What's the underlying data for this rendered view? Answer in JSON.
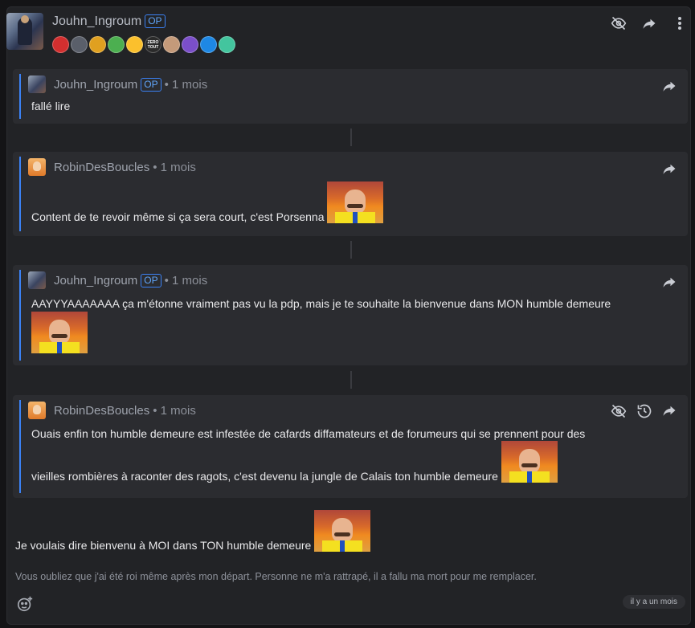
{
  "header": {
    "username": "Jouhn_Ingroum",
    "op": "OP",
    "badges": [
      {
        "icon": "crown-badge-icon",
        "color": "#d32f2f"
      },
      {
        "icon": "hexagon-badge-icon",
        "color": "#5a5f6a"
      },
      {
        "icon": "rainbow-badge-icon",
        "color": "#e0a020"
      },
      {
        "icon": "green-face-badge-icon",
        "color": "#4caf50"
      },
      {
        "icon": "smiley-badge-icon",
        "color": "#fbc02d"
      },
      {
        "icon": "zero-tout-badge-icon",
        "color": "#2a2a2a",
        "text": "ZERO TOUT"
      },
      {
        "icon": "face-badge-icon",
        "color": "#c49a7a"
      },
      {
        "icon": "moon-badge-icon",
        "color": "#7b4fc9"
      },
      {
        "icon": "eye-badge-icon",
        "color": "#1e88e5"
      },
      {
        "icon": "gem-badge-icon",
        "color": "#43c59e"
      }
    ],
    "icons": [
      "eye-off-icon",
      "share-icon",
      "more-vertical-icon"
    ]
  },
  "posts": [
    {
      "user": "Jouhn_Ingroum",
      "op": "OP",
      "time": "• 1 mois",
      "text": "fallé lire"
    },
    {
      "user": "RobinDesBoucles",
      "time": "• 1 mois",
      "text": "Content de te revoir même si ça sera court, c'est Porsenna"
    },
    {
      "user": "Jouhn_Ingroum",
      "op": "OP",
      "time": "• 1 mois",
      "text": "AAYYYAAAAAAA ça m'étonne vraiment pas vu la pdp, mais je te souhaite la bienvenue dans MON humble demeure"
    },
    {
      "user": "RobinDesBoucles",
      "time": "• 1 mois",
      "text1": "Ouais enfin ton humble demeure est infestée de cafards diffamateurs et de forumeurs qui se prennent pour des",
      "text2": "vieilles rombières à raconter des ragots, c'est devenu la jungle de Calais ton humble demeure"
    }
  ],
  "reply": "Je voulais dire bienvenu à MOI dans TON humble demeure",
  "signature": "Vous oubliez que j'ai été roi même après mon départ. Personne ne m'a rattrapé, il a fallu ma mort pour me remplacer.",
  "age": "il y a un mois"
}
